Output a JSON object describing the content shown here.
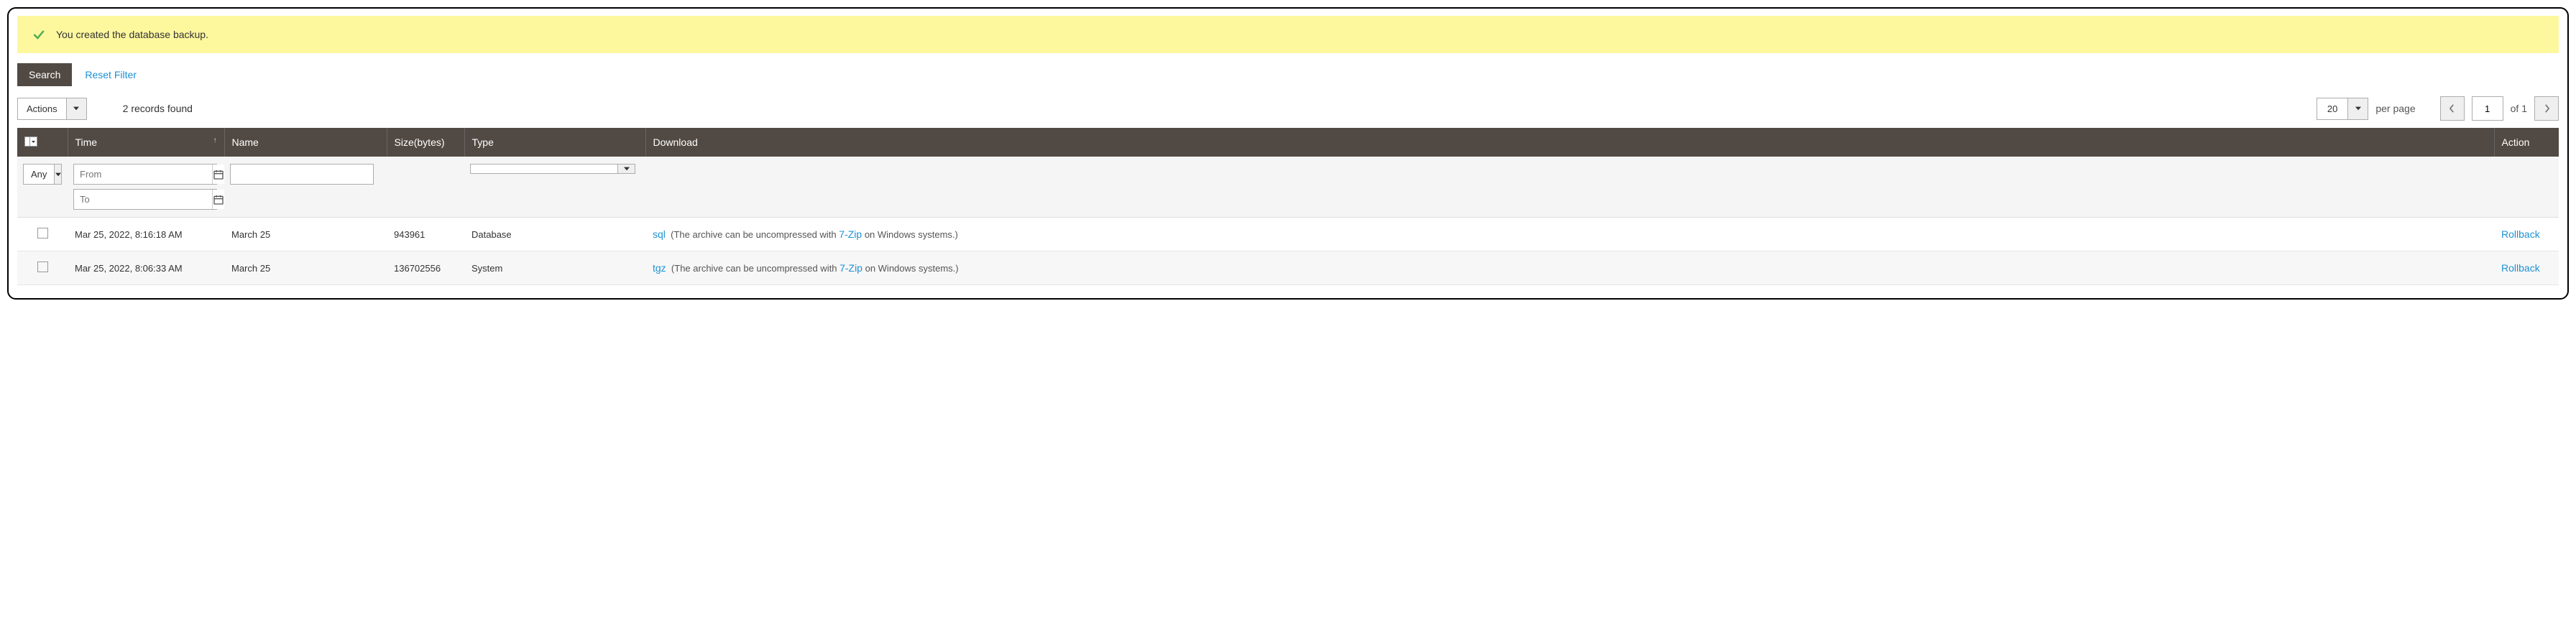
{
  "banner": {
    "text": "You created the database backup."
  },
  "toolbar": {
    "search_label": "Search",
    "reset_label": "Reset Filter",
    "actions_label": "Actions",
    "records_found": "2 records found",
    "per_page_value": "20",
    "per_page_label": "per page",
    "page_value": "1",
    "of_label": "of 1"
  },
  "headers": {
    "time": "Time",
    "name": "Name",
    "size": "Size(bytes)",
    "type": "Type",
    "download": "Download",
    "action": "Action"
  },
  "filters": {
    "any": "Any",
    "from_ph": "From",
    "to_ph": "To"
  },
  "rows": [
    {
      "time": "Mar 25, 2022, 8:16:18 AM",
      "name": "March 25",
      "size": "943961",
      "type": "Database",
      "dl_ext": "sql",
      "dl_prefix": "(The archive can be uncompressed with",
      "dl_link": "7-Zip",
      "dl_suffix": "on Windows systems.)",
      "action": "Rollback"
    },
    {
      "time": "Mar 25, 2022, 8:06:33 AM",
      "name": "March 25",
      "size": "136702556",
      "type": "System",
      "dl_ext": "tgz",
      "dl_prefix": "(The archive can be uncompressed with",
      "dl_link": "7-Zip",
      "dl_suffix": "on Windows systems.)",
      "action": "Rollback"
    }
  ]
}
